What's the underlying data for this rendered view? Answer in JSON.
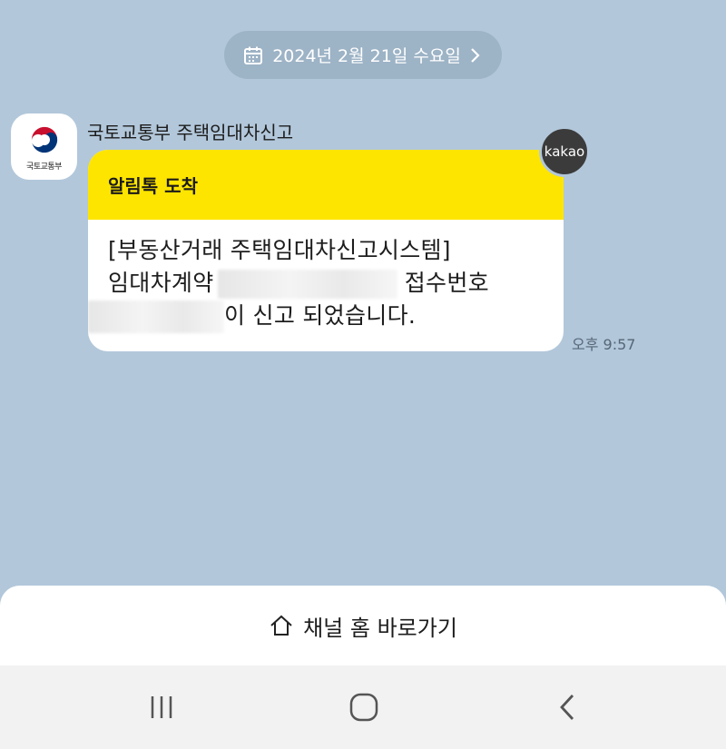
{
  "date_separator": {
    "label": "2024년 2월 21일 수요일",
    "icon": "calendar-icon",
    "chevron": "chevron-right-icon"
  },
  "sender": {
    "name": "국토교통부 주택임대차신고",
    "avatar_text": "국토교통부"
  },
  "message": {
    "header": "알림톡 도착",
    "line1": "[부동산거래 주택임대차신고시스템]",
    "line2": "임대차계약",
    "line2_suffix": " 접수번호",
    "line3_suffix": "이 신고 되었습니다.",
    "badge": "kakao",
    "time": "오후 9:57"
  },
  "bottom_button": {
    "label": "채널 홈 바로가기",
    "icon": "home-icon"
  },
  "navbar": {
    "items": [
      "recent-apps-icon",
      "home-icon",
      "back-icon"
    ]
  },
  "colors": {
    "background": "#b2c7da",
    "bubble_header": "#fee500",
    "badge": "#3b3b3b"
  }
}
